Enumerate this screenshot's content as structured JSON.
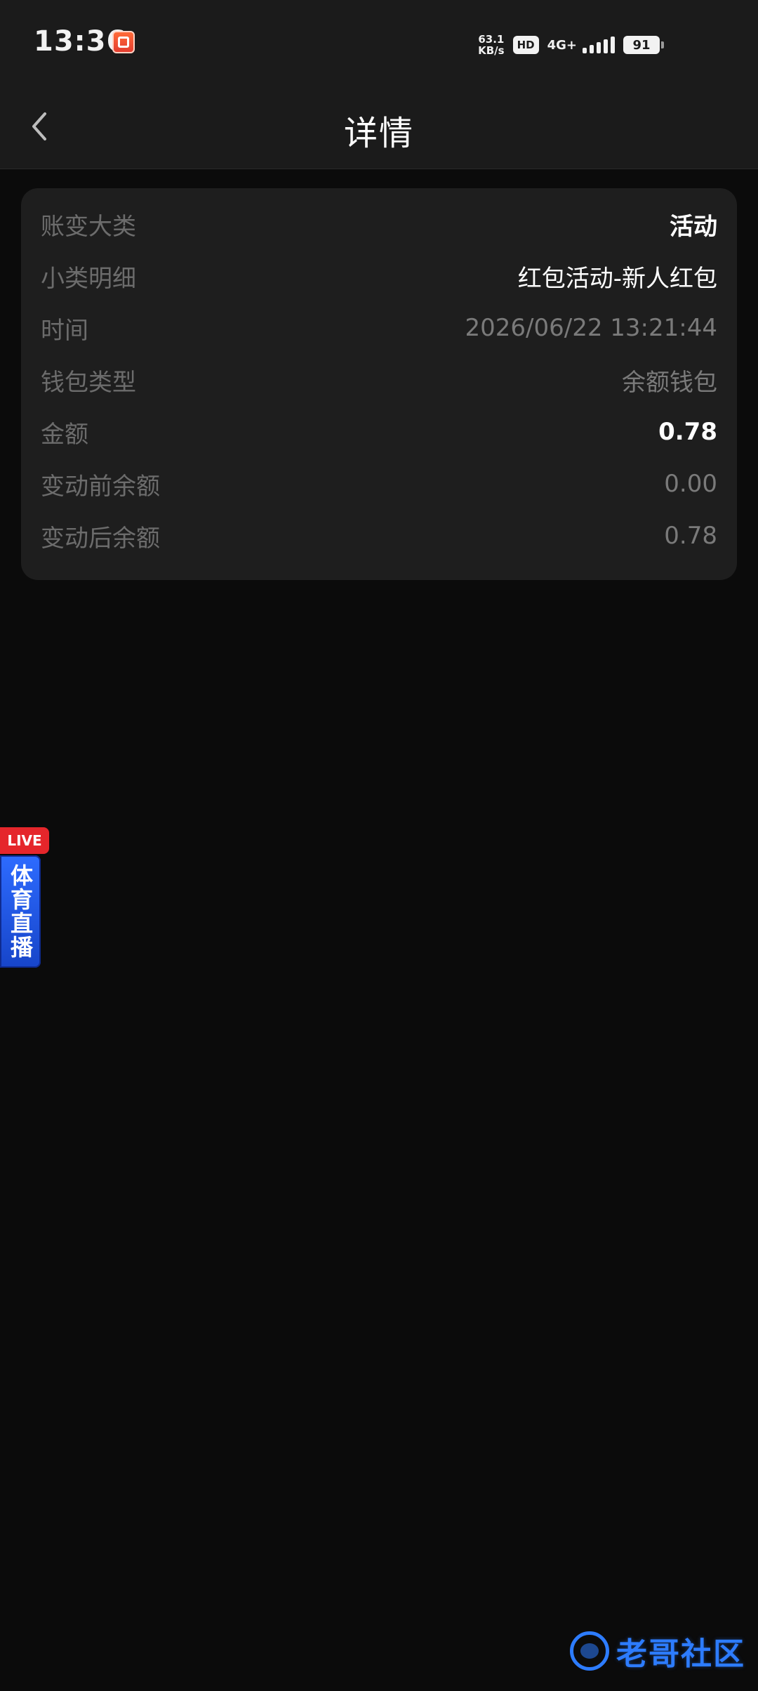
{
  "status_bar": {
    "time": "13:36",
    "net_speed_value": "63.1",
    "net_speed_unit": "KB/s",
    "hd_badge": "HD",
    "network_type": "4G+",
    "battery_level": "91"
  },
  "header": {
    "title": "详情"
  },
  "details": {
    "rows": [
      {
        "label": "账变大类",
        "value": "活动"
      },
      {
        "label": "小类明细",
        "value": "红包活动-新人红包"
      },
      {
        "label": "时间",
        "value": "2026/06/22 13:21:44"
      },
      {
        "label": "钱包类型",
        "value": "余额钱包"
      },
      {
        "label": "金额",
        "value": "0.78"
      },
      {
        "label": "变动前余额",
        "value": "0.00"
      },
      {
        "label": "变动后余额",
        "value": "0.78"
      }
    ]
  },
  "live_widget": {
    "badge": "LIVE",
    "text": "体育直播"
  },
  "watermark": {
    "text": "老哥社区"
  },
  "colors": {
    "background": "#0b0b0b",
    "header_bg": "#1b1b1b",
    "card_bg": "#1e1e1e",
    "label_text": "#6c6c6c",
    "live_red": "#e5262b",
    "live_blue": "#2d6bff"
  }
}
